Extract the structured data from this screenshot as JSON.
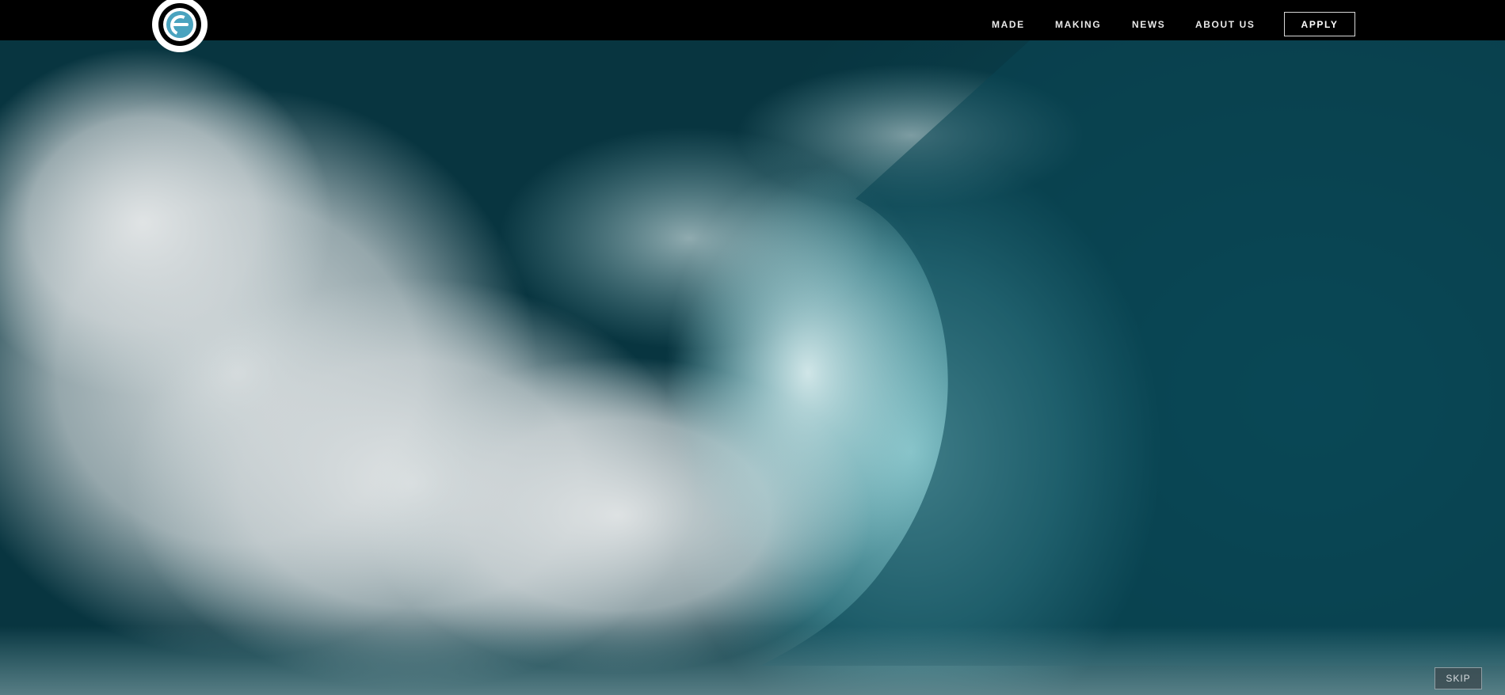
{
  "header": {
    "logo_icon": "e-circle-logo-icon",
    "nav": [
      {
        "label": "MADE"
      },
      {
        "label": "MAKING"
      },
      {
        "label": "NEWS"
      },
      {
        "label": "ABOUT US"
      }
    ],
    "apply_label": "APPLY"
  },
  "hero": {
    "media": "ocean-wave-video"
  },
  "player": {
    "skip_label": "SKIP"
  },
  "colors": {
    "topbar": "#000000",
    "logo_accent": "#4aa3bf",
    "wave_deep": "#0a4450",
    "wave_light": "#98c3c8"
  }
}
